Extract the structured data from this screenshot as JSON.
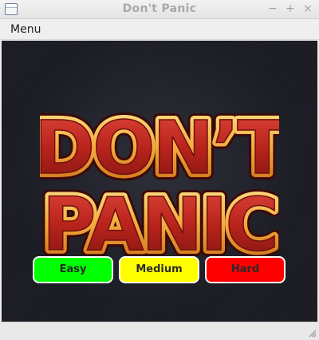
{
  "window": {
    "title": "Don't Panic",
    "icon": "app-window-icon",
    "controls": {
      "minimize": "−",
      "maximize": "+",
      "close": "×"
    }
  },
  "menubar": {
    "items": [
      {
        "label": "Menu"
      }
    ]
  },
  "game": {
    "logo": {
      "line1": "DON’T",
      "line2": "PANIC",
      "fill_color": "#c8281f",
      "outline_color": "#f2b233"
    },
    "difficulty": [
      {
        "label": "Easy",
        "color": "#00ff00"
      },
      {
        "label": "Medium",
        "color": "#ffff00"
      },
      {
        "label": "Hard",
        "color": "#ff0000"
      }
    ]
  },
  "colors": {
    "canvas_background": "#1c1d25",
    "button_border": "#ffffff"
  }
}
